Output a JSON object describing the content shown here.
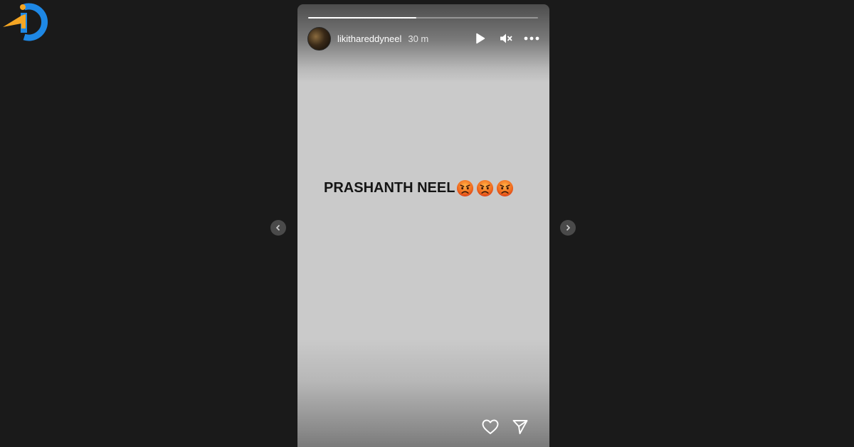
{
  "brand": {
    "logo_icon": "id-brand-logo",
    "colors": {
      "orange": "#f5a623",
      "blue": "#1e88e5"
    }
  },
  "story": {
    "progress": 0.47,
    "username": "likithareddyneel",
    "time_ago": "30 m",
    "caption": "PRASHANTH NEEL",
    "emoji_count": 3,
    "emoji_name": "angry-face-emoji"
  },
  "controls": {
    "play_icon": "play-icon",
    "mute_icon": "muted-speaker-icon",
    "more_icon": "more-options-icon"
  },
  "footer": {
    "like_icon": "heart-icon",
    "share_icon": "send-icon"
  },
  "navigation": {
    "prev_icon": "chevron-left-icon",
    "next_icon": "chevron-right-icon"
  }
}
